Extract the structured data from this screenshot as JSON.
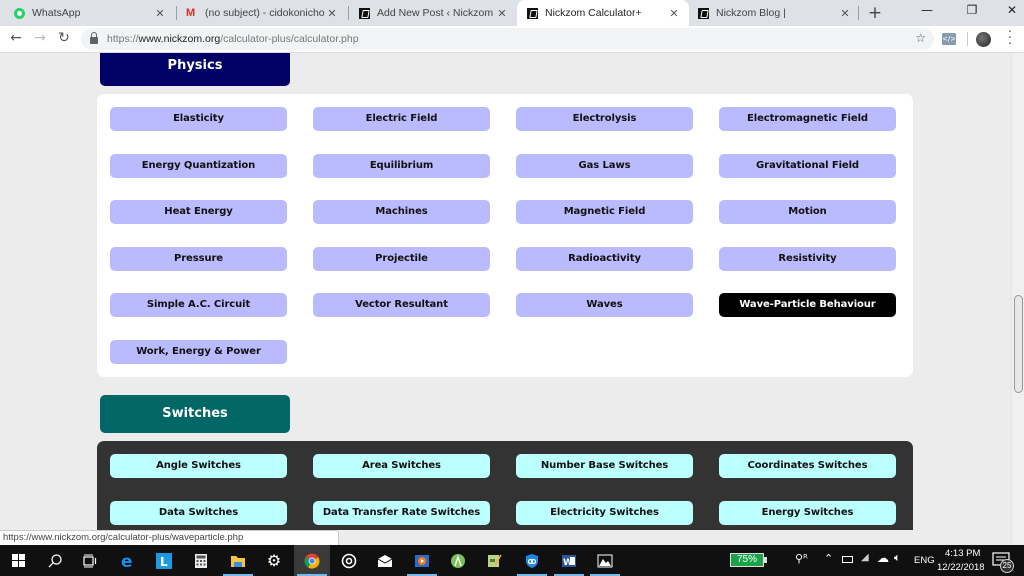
{
  "browser": {
    "tabs": [
      {
        "title": "WhatsApp",
        "favicon": "whatsapp-icon",
        "active": false
      },
      {
        "title": "(no subject) - cidokonicholas@",
        "favicon": "gmail-icon",
        "active": false
      },
      {
        "title": "Add New Post ‹ Nickzom Blog",
        "favicon": "nickzom-icon",
        "active": false
      },
      {
        "title": "Nickzom Calculator+",
        "favicon": "nickzom-icon",
        "active": true
      },
      {
        "title": "Nickzom Blog |",
        "favicon": "nickzom-icon",
        "active": false
      }
    ],
    "new_tab_label": "+",
    "close_glyph": "✕",
    "window_controls": {
      "minimize": "—",
      "restore": "❐",
      "close": "✕"
    },
    "nav": {
      "back": "←",
      "forward": "→",
      "reload": "↻"
    },
    "url": {
      "scheme": "https://",
      "host": "www.nickzom.org",
      "path": "/calculator-plus/calculator.php"
    },
    "star_glyph": "☆",
    "extension_label": "</>",
    "menu_glyph": "⋮"
  },
  "page": {
    "physics": {
      "title": "Physics",
      "header_color": "#000066",
      "button_color": "#babaff",
      "items": [
        "Elasticity",
        "Electric Field",
        "Electrolysis",
        "Electromagnetic Field",
        "Energy Quantization",
        "Equilibrium",
        "Gas Laws",
        "Gravitational Field",
        "Heat Energy",
        "Machines",
        "Magnetic Field",
        "Motion",
        "Pressure",
        "Projectile",
        "Radioactivity",
        "Resistivity",
        "Simple A.C. Circuit",
        "Vector Resultant",
        "Waves",
        "Wave-Particle Behaviour",
        "Work, Energy & Power"
      ],
      "hovered_item": "Wave-Particle Behaviour"
    },
    "switches": {
      "title": "Switches",
      "header_color": "#006666",
      "button_color": "#bbffff",
      "items": [
        "Angle Switches",
        "Area Switches",
        "Number Base Switches",
        "Coordinates Switches",
        "Data Switches",
        "Data Transfer Rate Switches",
        "Electricity Switches",
        "Energy Switches"
      ]
    }
  },
  "status_bar": {
    "link_url": "https://www.nickzom.org/calculator-plus/waveparticle.php"
  },
  "taskbar": {
    "apps": [
      {
        "name": "start-button"
      },
      {
        "name": "search-button"
      },
      {
        "name": "task-view-button"
      },
      {
        "name": "edge-app"
      },
      {
        "name": "l-app"
      },
      {
        "name": "calculator-app"
      },
      {
        "name": "file-explorer-app"
      },
      {
        "name": "settings-app"
      },
      {
        "name": "chrome-app"
      },
      {
        "name": "groove-app"
      },
      {
        "name": "mail-app"
      },
      {
        "name": "media-player-app"
      },
      {
        "name": "android-studio-app"
      },
      {
        "name": "notepad-app"
      },
      {
        "name": "vpn-app"
      },
      {
        "name": "word-app"
      },
      {
        "name": "photos-app"
      }
    ],
    "battery_percent": "75%",
    "language": "ENG",
    "time": "4:13 PM",
    "date": "12/22/2018",
    "notification_count": "25"
  }
}
